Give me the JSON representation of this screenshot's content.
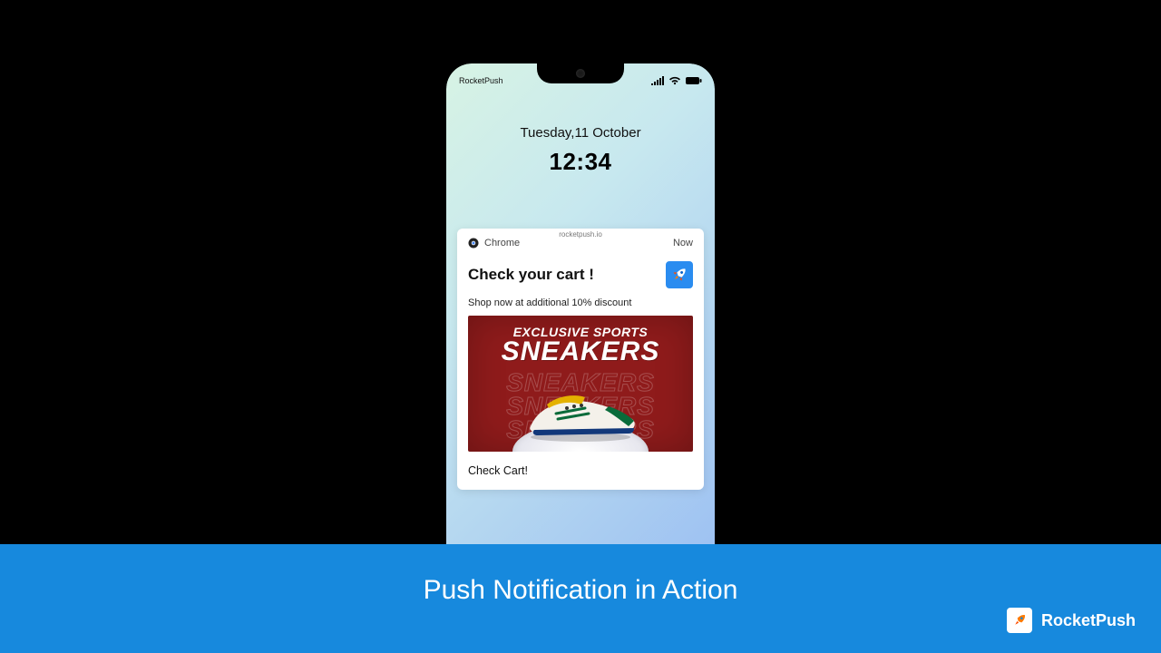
{
  "statusbar": {
    "carrier": "RocketPush"
  },
  "lockscreen": {
    "date": "Tuesday,11 October",
    "time": "12:34"
  },
  "notification": {
    "domain": "rocketpush.io",
    "app": "Chrome",
    "timestamp": "Now",
    "title": "Check your cart !",
    "body": "Shop now at additional 10% discount",
    "action": "Check Cart!",
    "promo": {
      "line1": "EXCLUSIVE SPORTS",
      "line2": "SNEAKERS",
      "ghost": "SNEAKERS"
    }
  },
  "banner": {
    "title": "Push Notification in Action",
    "brand": "RocketPush"
  }
}
